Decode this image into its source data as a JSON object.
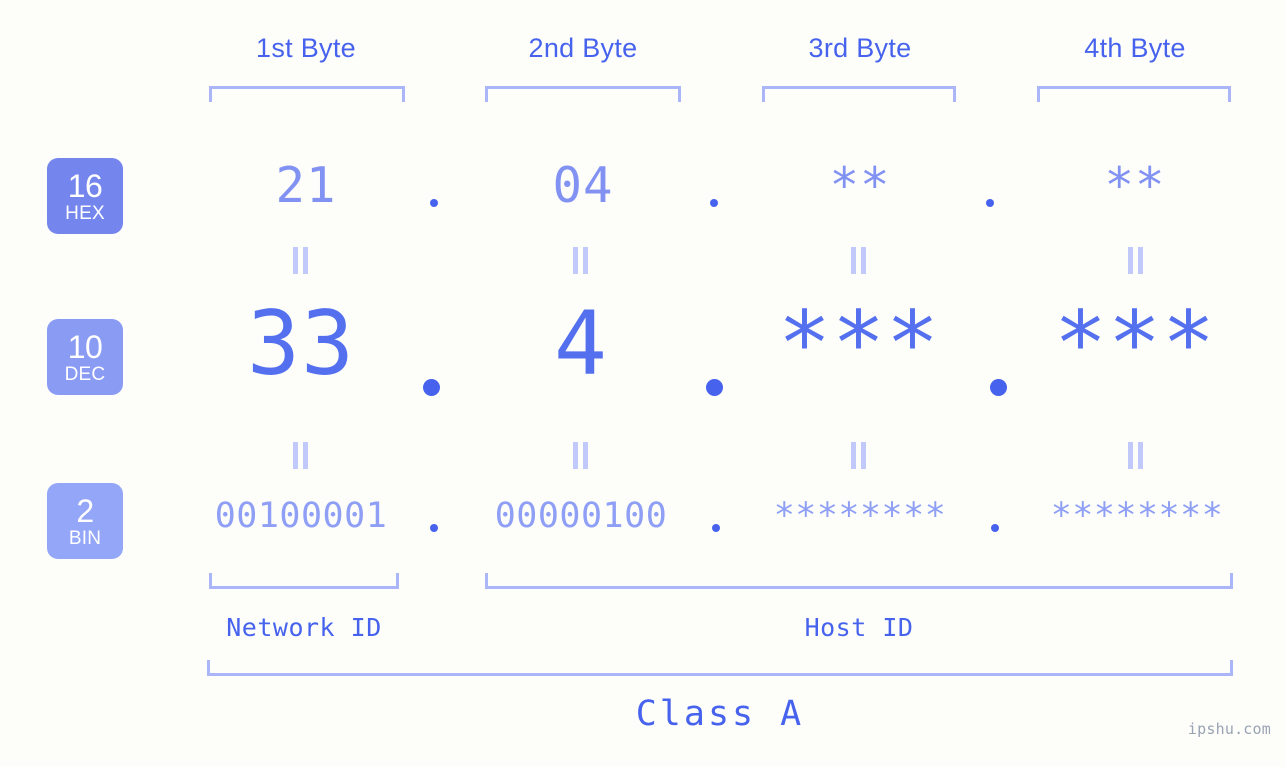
{
  "background_color": "#fdfefa",
  "accent_color": "#4763ee",
  "accent_light": "#aab6f7",
  "headers": {
    "byte1": "1st Byte",
    "byte2": "2nd Byte",
    "byte3": "3rd Byte",
    "byte4": "4th Byte"
  },
  "bases": [
    {
      "number": "16",
      "name": "HEX",
      "color": "#7486ee"
    },
    {
      "number": "10",
      "name": "DEC",
      "color": "#8a9bf4"
    },
    {
      "number": "2",
      "name": "BIN",
      "color": "#93a6f7"
    }
  ],
  "rows": {
    "hex": {
      "base_number": "16",
      "base_name": "HEX",
      "values": [
        "21",
        "04",
        "**",
        "**"
      ],
      "separator": "."
    },
    "dec": {
      "base_number": "10",
      "base_name": "DEC",
      "values": [
        "33",
        "4",
        "***",
        "***"
      ],
      "separator": "."
    },
    "bin": {
      "base_number": "2",
      "base_name": "BIN",
      "values": [
        "00100001",
        "00000100",
        "********",
        "********"
      ],
      "separator": "."
    }
  },
  "equivalence_mark": "||",
  "sections": {
    "network_id": "Network ID",
    "host_id": "Host ID"
  },
  "class_label": "Class A",
  "watermark": "ipshu.com"
}
